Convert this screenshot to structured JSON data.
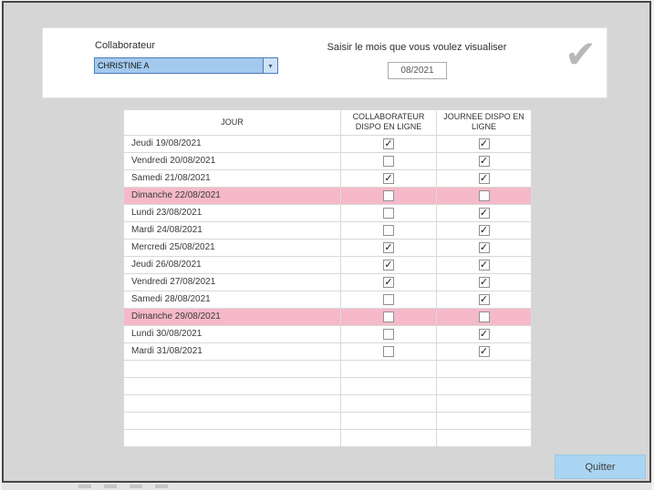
{
  "panel": {
    "collaborator_label": "Collaborateur",
    "collaborator_value": "CHRISTINE A",
    "month_label": "Saisir le mois que vous voulez visualiser",
    "month_value": "08/2021"
  },
  "table": {
    "columns": [
      "JOUR",
      "COLLABORATEUR DISPO EN LIGNE",
      "JOURNEE DISPO EN LIGNE"
    ],
    "rows": [
      {
        "day": "Jeudi 19/08/2021",
        "collab_dispo": true,
        "journee_dispo": true,
        "highlighted": false
      },
      {
        "day": "Vendredi 20/08/2021",
        "collab_dispo": false,
        "journee_dispo": true,
        "highlighted": false
      },
      {
        "day": "Samedi 21/08/2021",
        "collab_dispo": true,
        "journee_dispo": true,
        "highlighted": false
      },
      {
        "day": "Dimanche 22/08/2021",
        "collab_dispo": false,
        "journee_dispo": false,
        "highlighted": true
      },
      {
        "day": "Lundi 23/08/2021",
        "collab_dispo": false,
        "journee_dispo": true,
        "highlighted": false
      },
      {
        "day": "Mardi 24/08/2021",
        "collab_dispo": false,
        "journee_dispo": true,
        "highlighted": false
      },
      {
        "day": "Mercredi 25/08/2021",
        "collab_dispo": true,
        "journee_dispo": true,
        "highlighted": false
      },
      {
        "day": "Jeudi 26/08/2021",
        "collab_dispo": true,
        "journee_dispo": true,
        "highlighted": false
      },
      {
        "day": "Vendredi 27/08/2021",
        "collab_dispo": true,
        "journee_dispo": true,
        "highlighted": false
      },
      {
        "day": "Samedi 28/08/2021",
        "collab_dispo": false,
        "journee_dispo": true,
        "highlighted": false
      },
      {
        "day": "Dimanche 29/08/2021",
        "collab_dispo": false,
        "journee_dispo": false,
        "highlighted": true
      },
      {
        "day": "Lundi 30/08/2021",
        "collab_dispo": false,
        "journee_dispo": true,
        "highlighted": false
      },
      {
        "day": "Mardi 31/08/2021",
        "collab_dispo": false,
        "journee_dispo": true,
        "highlighted": false
      }
    ],
    "empty_rows": 5
  },
  "footer": {
    "quit_button": "Quitter"
  },
  "icons": {
    "check": "✔",
    "chevron_down": "▾",
    "checkbox_check": "✓"
  },
  "colors": {
    "window_bg": "#d6d6d6",
    "window_border": "#474747",
    "panel_bg": "#ffffff",
    "sunday_row": "#f5b9c9",
    "combobox_highlight": "#a3c9ee",
    "combobox_border": "#4a7db8",
    "quit_button_bg": "#a9d5f2",
    "check_icon": "#b9b9b9",
    "grid_line": "#d9d9d9"
  }
}
